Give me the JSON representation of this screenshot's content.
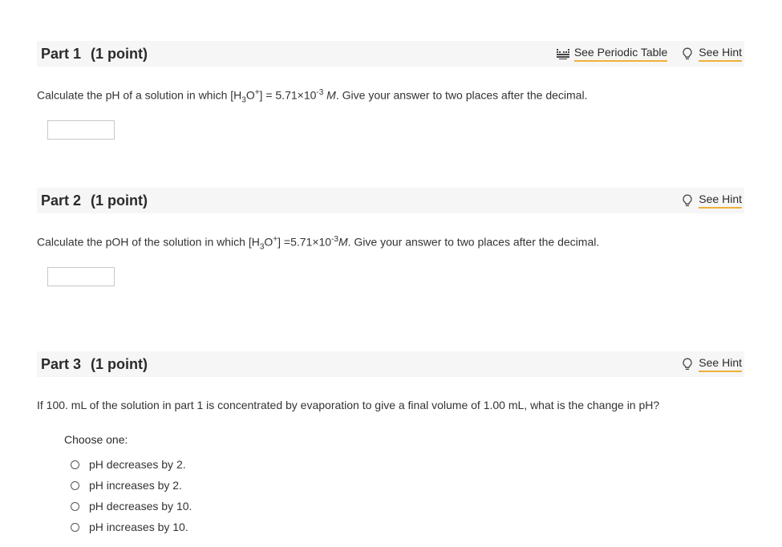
{
  "parts": [
    {
      "title": "Part 1",
      "points": "(1 point)",
      "periodic_label": "See Periodic Table",
      "hint_label": "See Hint",
      "q": {
        "pre": "Calculate the pH of a solution in which [H",
        "sub": "3",
        "mid": "O",
        "sup_charge": "+",
        "eq": "] = 5.71×10",
        "exp": "-3",
        "unit": " M",
        "post": ". Give your answer to two places after the decimal."
      },
      "input_value": ""
    },
    {
      "title": "Part 2",
      "points": "(1 point)",
      "hint_label": "See Hint",
      "q": {
        "pre": "Calculate the pOH of the solution in which [H",
        "sub": "3",
        "mid": "O",
        "sup_charge": "+",
        "eq": "] =5.71×10",
        "exp": "-3",
        "unit": "M",
        "post": ". Give your answer to two places after the decimal."
      },
      "input_value": ""
    },
    {
      "title": "Part 3",
      "points": "(1 point)",
      "hint_label": "See Hint",
      "question": "If 100. mL of the solution in part 1 is concentrated by evaporation to give a final volume of 1.00 mL, what is the change in pH?",
      "choose_label": "Choose one:",
      "choices": [
        "pH decreases by 2.",
        "pH increases by 2.",
        "pH decreases by 10.",
        "pH increases by 10."
      ]
    }
  ],
  "colors": {
    "header_bg": "#f6f6f6",
    "link_underline": "#f0b03a",
    "text": "#333333"
  },
  "icons": {
    "periodic": "periodic-table-icon",
    "hint": "lightbulb-icon"
  }
}
